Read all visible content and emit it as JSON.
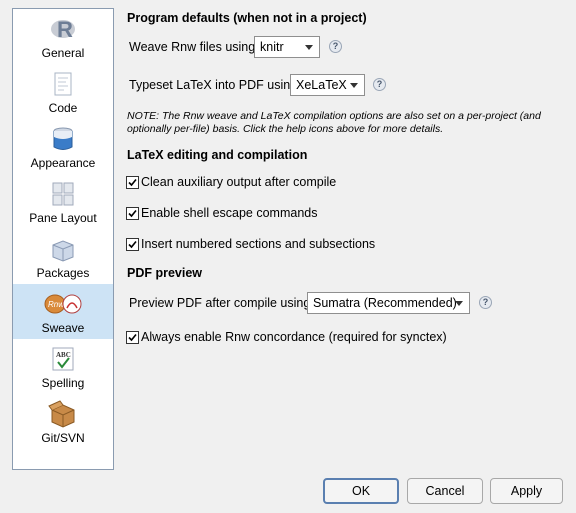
{
  "sidebar": {
    "items": [
      {
        "label": "General",
        "icon": "r-logo-icon"
      },
      {
        "label": "Code",
        "icon": "code-document-icon"
      },
      {
        "label": "Appearance",
        "icon": "paint-bucket-icon"
      },
      {
        "label": "Pane Layout",
        "icon": "pane-layout-icon"
      },
      {
        "label": "Packages",
        "icon": "package-box-icon"
      },
      {
        "label": "Sweave",
        "icon": "sweave-rnw-pdf-icon",
        "selected": true
      },
      {
        "label": "Spelling",
        "icon": "spelling-abc-check-icon"
      },
      {
        "label": "Git/SVN",
        "icon": "git-svn-box-icon"
      }
    ]
  },
  "program_defaults": {
    "heading": "Program defaults (when not in a project)",
    "weave_label": "Weave Rnw files using:",
    "weave_value": "knitr",
    "typeset_label": "Typeset LaTeX into PDF using:",
    "typeset_value": "XeLaTeX",
    "note": "NOTE: The Rnw weave and LaTeX compilation options are also set on a per-project (and optionally per-file) basis. Click the help icons above for more details."
  },
  "latex_section": {
    "heading": "LaTeX editing and compilation",
    "options": [
      {
        "label": "Clean auxiliary output after compile",
        "checked": true
      },
      {
        "label": "Enable shell escape commands",
        "checked": true
      },
      {
        "label": "Insert numbered sections and subsections",
        "checked": true
      }
    ]
  },
  "pdf_preview": {
    "heading": "PDF preview",
    "preview_label": "Preview PDF after compile using:",
    "preview_value": "Sumatra (Recommended)",
    "concordance_label": "Always enable Rnw concordance (required for synctex)",
    "concordance_checked": true
  },
  "help_glyph": "?",
  "buttons": {
    "ok": "OK",
    "cancel": "Cancel",
    "apply": "Apply"
  }
}
